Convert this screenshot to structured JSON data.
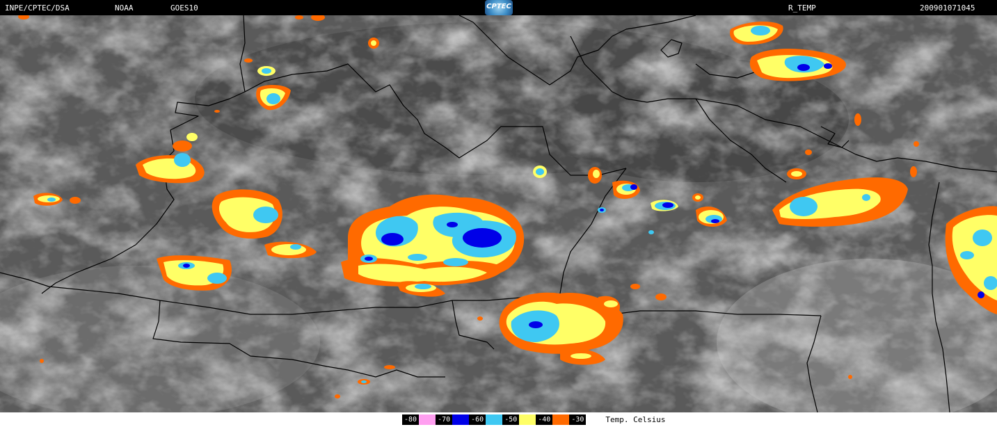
{
  "header": {
    "source": "INPE/CPTEC/DSA",
    "agency": "NOAA",
    "satellite": "GOES10",
    "logo_text": "CPTEC",
    "product": "R_TEMP",
    "datetime": "200901071045"
  },
  "legend": {
    "unit": "Temp. Celsius",
    "items": [
      {
        "label": "-80",
        "color": "#ff9ff0"
      },
      {
        "label": "-70",
        "color": "#0000e8"
      },
      {
        "label": "-60",
        "color": "#3fc8f2"
      },
      {
        "label": "-50",
        "color": "#ffff66"
      },
      {
        "label": "-40",
        "color": "#ff6a00"
      },
      {
        "label": "-30",
        "color": "#ffffff"
      }
    ]
  },
  "map": {
    "background_colors": [
      "#4a4a4a",
      "#9a9a9a",
      "#c8c8c8"
    ],
    "border_color": "#000000"
  }
}
